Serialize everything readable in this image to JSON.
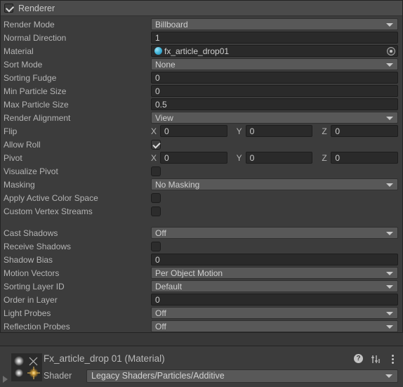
{
  "component": {
    "title": "Renderer",
    "enabled_checkbox": true,
    "groups": [
      {
        "name": "main",
        "rows": [
          {
            "label": "Render Mode",
            "type": "dropdown",
            "value": "Billboard"
          },
          {
            "label": "Normal Direction",
            "type": "field",
            "value": "1"
          },
          {
            "label": "Material",
            "type": "object",
            "value": "fx_article_drop01"
          },
          {
            "label": "Sort Mode",
            "type": "dropdown",
            "value": "None"
          },
          {
            "label": "Sorting Fudge",
            "type": "field",
            "value": "0"
          },
          {
            "label": "Min Particle Size",
            "type": "field",
            "value": "0"
          },
          {
            "label": "Max Particle Size",
            "type": "field",
            "value": "0.5"
          },
          {
            "label": "Render Alignment",
            "type": "dropdown",
            "value": "View"
          },
          {
            "label": "Flip",
            "type": "xyz",
            "axes": [
              "X",
              "Y",
              "Z"
            ],
            "values": [
              "0",
              "0",
              "0"
            ]
          },
          {
            "label": "Allow Roll",
            "type": "checkbox",
            "checked": true
          },
          {
            "label": "Pivot",
            "type": "xyz",
            "axes": [
              "X",
              "Y",
              "Z"
            ],
            "values": [
              "0",
              "0",
              "0"
            ]
          },
          {
            "label": "Visualize Pivot",
            "type": "checkbox",
            "checked": false
          },
          {
            "label": "Masking",
            "type": "dropdown",
            "value": "No Masking"
          },
          {
            "label": "Apply Active Color Space",
            "type": "checkbox",
            "checked": false
          },
          {
            "label": "Custom Vertex Streams",
            "type": "checkbox",
            "checked": false
          }
        ]
      },
      {
        "name": "lighting",
        "rows": [
          {
            "label": "Cast Shadows",
            "type": "dropdown",
            "value": "Off"
          },
          {
            "label": "Receive Shadows",
            "type": "checkbox",
            "checked": false
          },
          {
            "label": "Shadow Bias",
            "type": "field",
            "value": "0"
          },
          {
            "label": "Motion Vectors",
            "type": "dropdown",
            "value": "Per Object Motion"
          },
          {
            "label": "Sorting Layer ID",
            "type": "dropdown",
            "value": "Default"
          },
          {
            "label": "Order in Layer",
            "type": "field",
            "value": "0"
          },
          {
            "label": "Light Probes",
            "type": "dropdown",
            "value": "Off"
          },
          {
            "label": "Reflection Probes",
            "type": "dropdown",
            "value": "Off"
          }
        ]
      }
    ]
  },
  "material_panel": {
    "title": "Fx_article_drop 01 (Material)",
    "thumbnail_name": "material-preview-thumbnail",
    "icons": [
      {
        "name": "help-icon",
        "glyph": "?"
      },
      {
        "name": "preset-icon",
        "glyph": "preset"
      },
      {
        "name": "menu-icon",
        "glyph": "kebab"
      }
    ],
    "shader": {
      "label": "Shader",
      "value": "Legacy Shaders/Particles/Additive"
    },
    "foldout_expanded": false
  },
  "colors": {
    "panel_background": "#3c3c3c",
    "window_background": "#383838",
    "header_background": "#4b4b4b",
    "dropdown_background": "#585858",
    "field_background": "#2a2a2a",
    "text": "#b4b4b4",
    "object_icon": "#47b9dd"
  }
}
